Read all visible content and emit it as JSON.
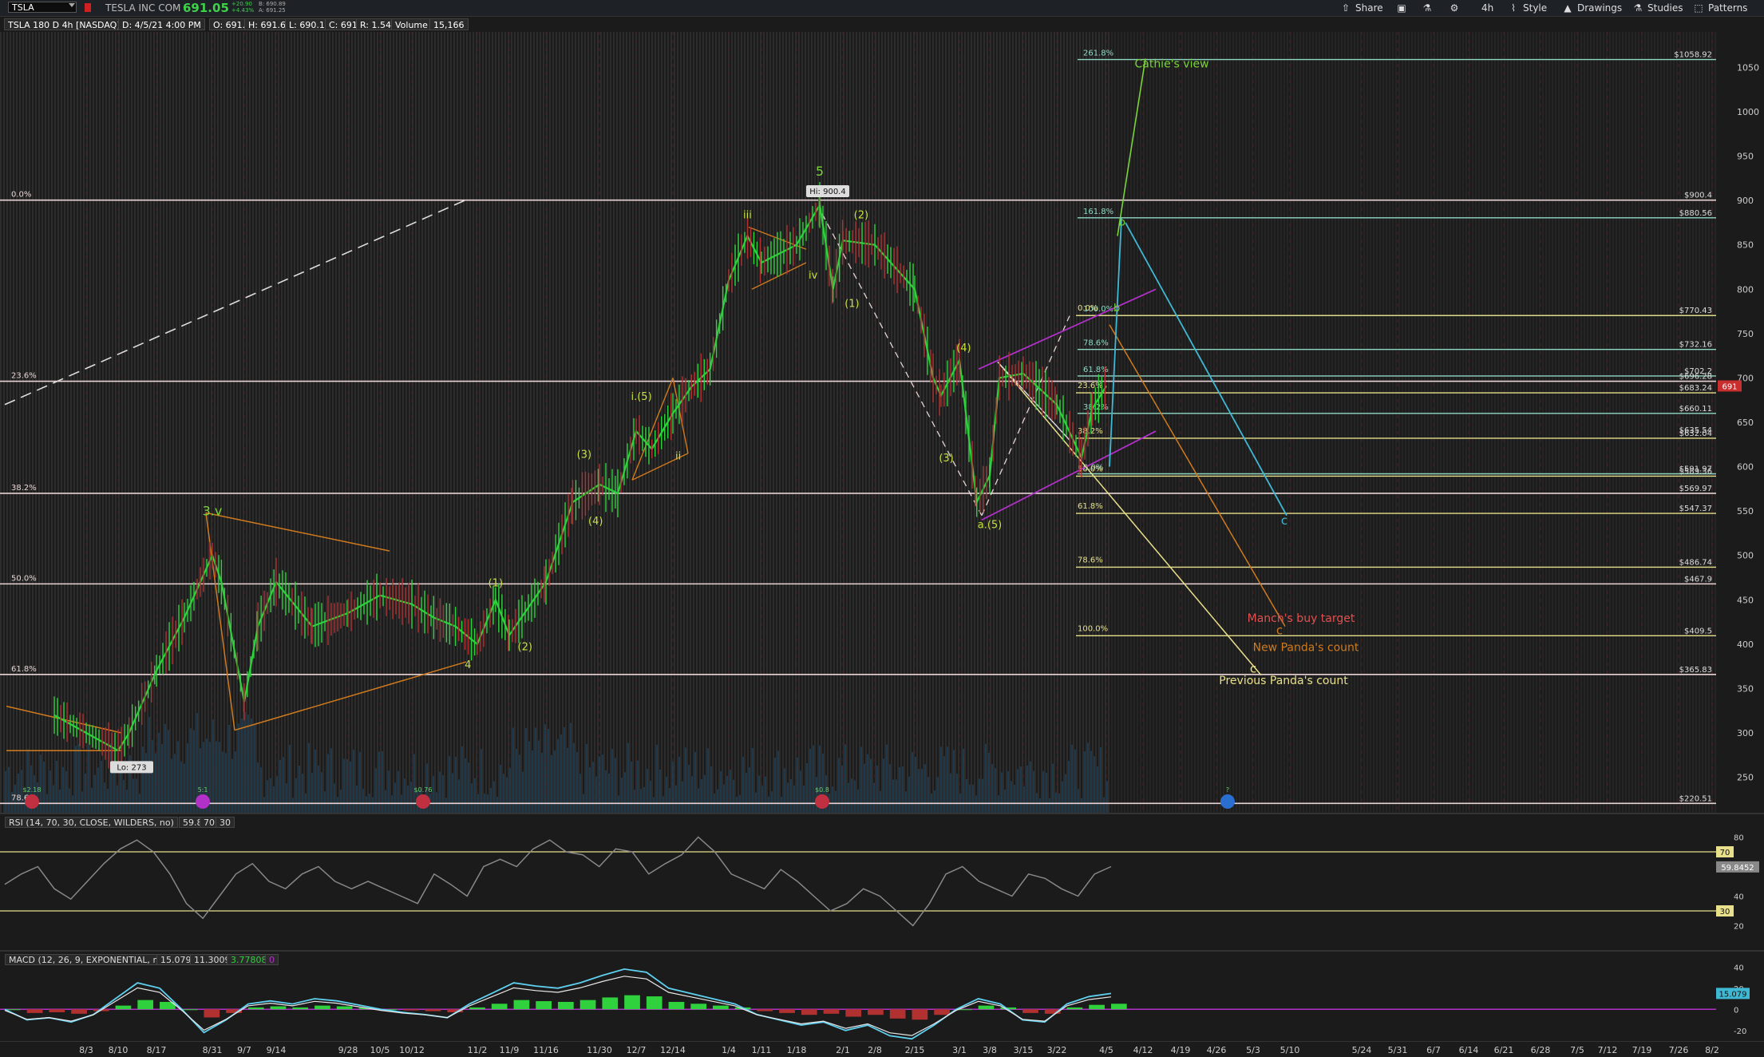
{
  "header": {
    "symbol": "TSLA",
    "company": "TESLA INC COM",
    "last_price": "691.05",
    "change": "+20.90",
    "change_pct": "+4.43%",
    "bid": "B: 690.89",
    "ask": "A: 691.25",
    "toolbar": {
      "share": "Share",
      "timeframe": "4h",
      "style": "Style",
      "drawings": "Drawings",
      "studies": "Studies",
      "patterns": "Patterns"
    }
  },
  "status": {
    "title": "TSLA 180 D 4h [NASDAQ]",
    "date": "D: 4/5/21 4:00 PM",
    "open": "O: 691.5",
    "high": "H: 691.65",
    "low": "L: 690.11",
    "close": "C: 691",
    "range": "R: 1.54",
    "volume_label": "Volume",
    "volume_value": "15,166"
  },
  "colors": {
    "up": "#2fd13c",
    "down": "#b13030",
    "green_label": "#7ad43a",
    "orange": "#d07a1e",
    "yellow": "#e8e08a",
    "cyan": "#3fb8d4",
    "magenta": "#b030c8",
    "fib_white": "#e8d4d4",
    "fib_teal": "#8fd8c4"
  },
  "chart_data": {
    "type": "line",
    "title": "TSLA 180 D 4h [NASDAQ]",
    "y_axis": {
      "range": [
        210,
        1090
      ],
      "ticks": [
        250,
        300,
        350,
        400,
        450,
        500,
        550,
        600,
        650,
        700,
        750,
        800,
        850,
        900,
        950,
        1000,
        1050
      ]
    },
    "x_axis": {
      "ticks": [
        "8/3",
        "8/10",
        "8/17",
        "8/31",
        "9/7",
        "9/14",
        "9/28",
        "10/5",
        "10/12",
        "11/2",
        "11/9",
        "11/16",
        "11/30",
        "12/7",
        "12/14",
        "1/4",
        "1/11",
        "1/18",
        "2/1",
        "2/8",
        "2/15",
        "3/1",
        "3/8",
        "3/15",
        "3/22",
        "4/5",
        "4/12",
        "4/19",
        "4/26",
        "5/3",
        "5/10",
        "5/24",
        "5/31",
        "6/7",
        "6/14",
        "6/21",
        "6/28",
        "7/5",
        "7/12",
        "7/19",
        "7/26",
        "8/2"
      ]
    },
    "price_series": [
      {
        "x": "7/27",
        "y": 320
      },
      {
        "x": "8/3",
        "y": 300
      },
      {
        "x": "8/10",
        "y": 280
      },
      {
        "x": "8/12",
        "y": 300
      },
      {
        "x": "8/17",
        "y": 370
      },
      {
        "x": "8/24",
        "y": 430
      },
      {
        "x": "8/31",
        "y": 500
      },
      {
        "x": "9/2",
        "y": 470
      },
      {
        "x": "9/7",
        "y": 335
      },
      {
        "x": "9/10",
        "y": 420
      },
      {
        "x": "9/14",
        "y": 470
      },
      {
        "x": "9/21",
        "y": 420
      },
      {
        "x": "9/28",
        "y": 435
      },
      {
        "x": "10/5",
        "y": 455
      },
      {
        "x": "10/12",
        "y": 445
      },
      {
        "x": "10/19",
        "y": 430
      },
      {
        "x": "10/26",
        "y": 420
      },
      {
        "x": "11/2",
        "y": 400
      },
      {
        "x": "11/6",
        "y": 450
      },
      {
        "x": "11/9",
        "y": 410
      },
      {
        "x": "11/16",
        "y": 470
      },
      {
        "x": "11/23",
        "y": 560
      },
      {
        "x": "11/30",
        "y": 580
      },
      {
        "x": "12/3",
        "y": 570
      },
      {
        "x": "12/7",
        "y": 640
      },
      {
        "x": "12/10",
        "y": 620
      },
      {
        "x": "12/14",
        "y": 660
      },
      {
        "x": "12/21",
        "y": 690
      },
      {
        "x": "12/28",
        "y": 710
      },
      {
        "x": "1/4",
        "y": 810
      },
      {
        "x": "1/8",
        "y": 860
      },
      {
        "x": "1/11",
        "y": 830
      },
      {
        "x": "1/18",
        "y": 850
      },
      {
        "x": "1/25",
        "y": 895
      },
      {
        "x": "1/29",
        "y": 800
      },
      {
        "x": "2/1",
        "y": 855
      },
      {
        "x": "2/8",
        "y": 850
      },
      {
        "x": "2/15",
        "y": 800
      },
      {
        "x": "2/22",
        "y": 700
      },
      {
        "x": "2/25",
        "y": 680
      },
      {
        "x": "3/1",
        "y": 720
      },
      {
        "x": "3/5",
        "y": 560
      },
      {
        "x": "3/8",
        "y": 590
      },
      {
        "x": "3/10",
        "y": 700
      },
      {
        "x": "3/15",
        "y": 705
      },
      {
        "x": "3/22",
        "y": 670
      },
      {
        "x": "3/29",
        "y": 610
      },
      {
        "x": "4/1",
        "y": 665
      },
      {
        "x": "4/5",
        "y": 691
      }
    ],
    "price_labels": {
      "high": "Hi: 900.4",
      "low": "Lo: 273",
      "current": "691",
      "right_levels": [
        "$1058.92",
        "$900.4",
        "$880.56",
        "$770.43",
        "$732.16",
        "$702.2",
        "$696.28",
        "$683.24",
        "$660.11",
        "$635.54",
        "$632.04",
        "$591.97",
        "$589.36",
        "$569.97",
        "$547.37",
        "$486.74",
        "$467.9",
        "$409.5",
        "$365.83",
        "$220.51"
      ]
    },
    "fib_retracement_big": [
      {
        "label": "0.0%",
        "price": 900.4
      },
      {
        "label": "23.6%",
        "price": 696.28
      },
      {
        "label": "38.2%",
        "price": 569.97
      },
      {
        "label": "50.0%",
        "price": 467.9
      },
      {
        "label": "61.8%",
        "price": 365.83
      },
      {
        "label": "78.6%",
        "price": 220.51
      }
    ],
    "fib_extension_up": [
      {
        "label": "261.8%",
        "price": 1058.92
      },
      {
        "label": "161.8%",
        "price": 880.56
      },
      {
        "label": "100.0%",
        "price": 770.43
      },
      {
        "label": "78.6%",
        "price": 732.16
      },
      {
        "label": "61.8%",
        "price": 702.2
      },
      {
        "label": "38.2%",
        "price": 660.11
      },
      {
        "label": "0.0%",
        "price": 591.97
      }
    ],
    "fib_extension_down": [
      {
        "label": "0.0%",
        "price": 770.43
      },
      {
        "label": "23.6%",
        "price": 683.24
      },
      {
        "label": "38.2%",
        "price": 632.04
      },
      {
        "label": "50.0%",
        "price": 589.36
      },
      {
        "label": "61.8%",
        "price": 547.37
      },
      {
        "label": "78.6%",
        "price": 486.74
      },
      {
        "label": "100.0%",
        "price": 409.5
      }
    ],
    "wave_labels": [
      {
        "text": "3.v",
        "x": "8/31",
        "y": 545
      },
      {
        "text": "4",
        "x": "10/30",
        "y": 373
      },
      {
        "text": "(1)",
        "x": "11/6",
        "y": 465
      },
      {
        "text": "(2)",
        "x": "11/12",
        "y": 393
      },
      {
        "text": "(3)",
        "x": "11/26",
        "y": 610
      },
      {
        "text": "(4)",
        "x": "11/29",
        "y": 535
      },
      {
        "text": "i.(5)",
        "x": "12/8",
        "y": 675
      },
      {
        "text": "ii",
        "x": "12/16",
        "y": 608
      },
      {
        "text": "iii",
        "x": "1/8",
        "y": 880
      },
      {
        "text": "iv",
        "x": "1/23",
        "y": 812
      },
      {
        "text": "5",
        "x": "1/25",
        "y": 928
      },
      {
        "text": "(1)",
        "x": "2/3",
        "y": 780
      },
      {
        "text": "(2)",
        "x": "2/5",
        "y": 880
      },
      {
        "text": "(3)",
        "x": "2/27",
        "y": 606
      },
      {
        "text": "(4)",
        "x": "3/2",
        "y": 730
      },
      {
        "text": "a.(5)",
        "x": "3/8",
        "y": 531
      },
      {
        "text": "b",
        "x": "4/7",
        "y": 775
      },
      {
        "text": "b",
        "x": "4/8",
        "y": 872
      }
    ],
    "annotations": [
      {
        "text": "Cathie's view",
        "color": "green"
      },
      {
        "text": "Manch's buy target",
        "color": "red"
      },
      {
        "text": "New Panda's count",
        "color": "orange"
      },
      {
        "text": "Previous Panda's count",
        "color": "yellow"
      },
      {
        "text": "c",
        "color": "cyan"
      },
      {
        "text": "c",
        "color": "orange"
      },
      {
        "text": "c",
        "color": "yellow"
      }
    ],
    "event_markers": [
      "$2.18",
      "5:1",
      "$0.76",
      "$0.8",
      "?"
    ]
  },
  "rsi": {
    "label": "RSI (14, 70, 30, CLOSE, WILDERS, no)",
    "value": "59.8452",
    "overbought": "70",
    "oversold": "30",
    "range": [
      10,
      90
    ],
    "ticks": [
      20,
      40,
      60,
      80
    ],
    "series": [
      48,
      55,
      60,
      45,
      38,
      50,
      62,
      72,
      78,
      70,
      55,
      35,
      25,
      40,
      55,
      62,
      50,
      45,
      55,
      60,
      50,
      45,
      50,
      45,
      40,
      35,
      55,
      48,
      40,
      60,
      65,
      60,
      72,
      78,
      70,
      68,
      60,
      72,
      70,
      55,
      62,
      68,
      80,
      70,
      55,
      50,
      45,
      58,
      50,
      40,
      30,
      35,
      45,
      40,
      30,
      20,
      35,
      55,
      60,
      50,
      45,
      40,
      55,
      52,
      45,
      40,
      55,
      60
    ]
  },
  "macd": {
    "label": "MACD (12, 26, 9, EXPONENTIAL, no)",
    "value": "15.079",
    "avg": "11.3009",
    "diff": "3.77808",
    "zero": "0",
    "range": [
      -30,
      50
    ],
    "ticks": [
      -20,
      0,
      20,
      40
    ],
    "series": [
      0,
      -10,
      -8,
      -12,
      -5,
      10,
      25,
      20,
      0,
      -22,
      -10,
      5,
      8,
      5,
      10,
      8,
      4,
      0,
      -3,
      -5,
      -8,
      5,
      15,
      25,
      22,
      20,
      25,
      32,
      38,
      35,
      20,
      15,
      10,
      5,
      -5,
      -10,
      -15,
      -12,
      -20,
      -15,
      -25,
      -28,
      -15,
      0,
      10,
      5,
      -10,
      -12,
      5,
      12,
      15
    ]
  }
}
